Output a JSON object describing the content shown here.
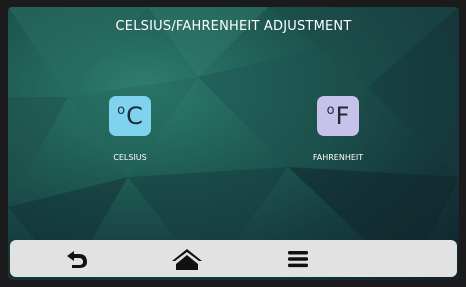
{
  "screen": {
    "title": "CELSIUS/FAHRENHEIT ADJUSTMENT"
  },
  "units": [
    {
      "symbol": "C",
      "degree": "o",
      "label": "CELSIUS",
      "color": "#7fd3ee"
    },
    {
      "symbol": "F",
      "degree": "o",
      "label": "FAHRENHEIT",
      "color": "#c7c2ea"
    }
  ],
  "nav": {
    "icons": [
      "back-arrow-icon",
      "home-icon",
      "menu-icon"
    ]
  },
  "colors": {
    "bar": "#e2e2e2",
    "icon": "#111111"
  }
}
